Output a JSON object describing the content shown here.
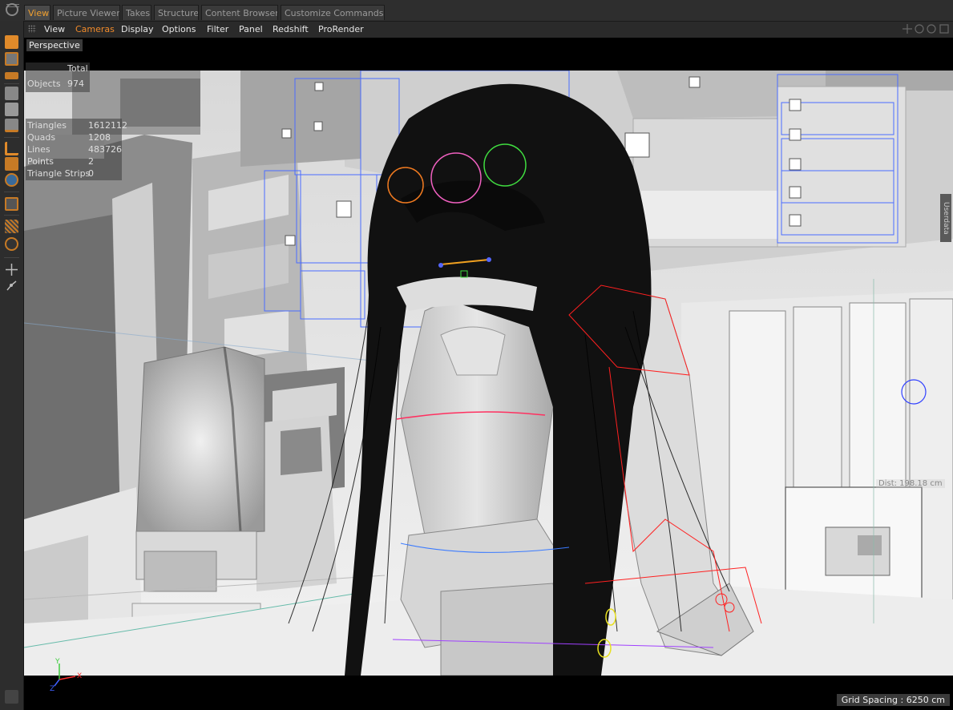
{
  "tabs": [
    "View",
    "Picture Viewer",
    "Takes",
    "Structure",
    "Content Browser",
    "Customize Commands..."
  ],
  "menu": [
    "View",
    "Cameras",
    "Display",
    "Options",
    "Filter",
    "Panel",
    "Redshift",
    "ProRender"
  ],
  "viewport": {
    "camera_label": "Perspective",
    "stats_header": "Total",
    "objects_label": "Objects",
    "objects_value": "974",
    "triangles_label": "Triangles",
    "triangles_value": "1612112",
    "quads_label": "Quads",
    "quads_value": "1208",
    "lines_label": "Lines",
    "lines_value": "483726",
    "points_label": "Points",
    "points_value": "2",
    "strips_label": "Triangle Strips",
    "strips_value": "0",
    "distance_label": "Dist: 198.18 cm",
    "userdata_label": "Userdata",
    "grid_spacing": "Grid Spacing : 6250 cm",
    "axis_x": "X",
    "axis_y": "Y",
    "axis_z": "Z"
  },
  "colors": {
    "active_tab": "#f0a030",
    "selected_menu": "#f08a2a",
    "wire_blue": "#4a6cff",
    "wire_red": "#ff2020"
  },
  "icons": [
    "sphere-tool-icon",
    "cube-icon",
    "texture-icon",
    "plane-icon",
    "cube-small-icon",
    "cube-small-icon",
    "cube-small-icon",
    "snap-icon",
    "lock-icon",
    "globe-icon",
    "brush-icon",
    "grid-icon",
    "twist-icon",
    "move-icon",
    "joint-icon"
  ]
}
